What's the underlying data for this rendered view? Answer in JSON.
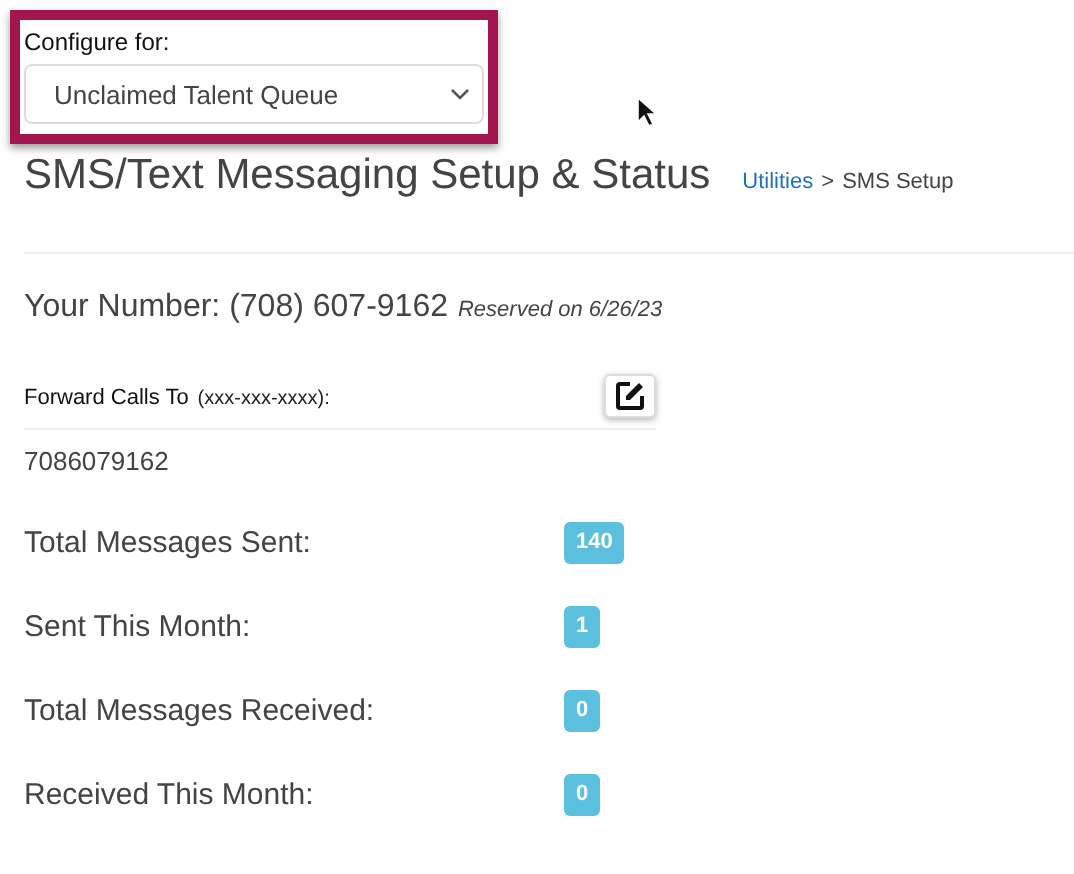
{
  "configure": {
    "label": "Configure for:",
    "value": "Unclaimed Talent Queue"
  },
  "title": "SMS/Text Messaging Setup & Status",
  "breadcrumb": {
    "link": "Utilities",
    "separator": ">",
    "current": "SMS Setup"
  },
  "number": {
    "label": "Your Number: (708) 607-9162",
    "note": "Reserved on 6/26/23"
  },
  "forward": {
    "label": "Forward Calls To",
    "hint": "(xxx-xxx-xxxx):",
    "value": "7086079162"
  },
  "stats": [
    {
      "label": "Total Messages Sent:",
      "count": "140"
    },
    {
      "label": "Sent This Month:",
      "count": "1"
    },
    {
      "label": "Total Messages Received:",
      "count": "0"
    },
    {
      "label": "Received This Month:",
      "count": "0"
    }
  ]
}
